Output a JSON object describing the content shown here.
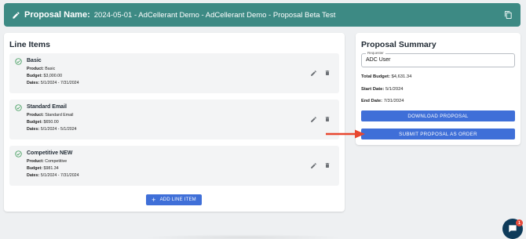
{
  "header": {
    "title_label": "Proposal Name:",
    "title_value": "2024-05-01 - AdCellerant Demo - AdCellerant Demo - Proposal Beta Test",
    "edit_icon": "pencil-icon",
    "copy_icon": "copy-icon"
  },
  "line_items": {
    "title": "Line Items",
    "items": [
      {
        "name": "Basic",
        "product_label": "Product:",
        "product": "Basic",
        "budget_label": "Budget:",
        "budget": "$3,000.00",
        "dates_label": "Dates:",
        "dates": "5/1/2024 - 7/31/2024"
      },
      {
        "name": "Standard Email",
        "product_label": "Product:",
        "product": "Standard Email",
        "budget_label": "Budget:",
        "budget": "$650.00",
        "dates_label": "Dates:",
        "dates": "5/1/2024 - 5/1/2024"
      },
      {
        "name": "Competitive NEW",
        "product_label": "Product:",
        "product": "Competitive",
        "budget_label": "Budget:",
        "budget": "$981.34",
        "dates_label": "Dates:",
        "dates": "5/1/2024 - 7/31/2024"
      }
    ],
    "add_button": "ADD LINE ITEM"
  },
  "summary": {
    "title": "Proposal Summary",
    "requester_label": "Requester",
    "requester_value": "ADC User",
    "total_budget_label": "Total Budget:",
    "total_budget": "$4,631.34",
    "start_date_label": "Start Date:",
    "start_date": "5/1/2024",
    "end_date_label": "End Date:",
    "end_date": "7/31/2024",
    "download_button": "DOWNLOAD PROPOSAL",
    "submit_button": "SUBMIT PROPOSAL AS ORDER"
  },
  "chat": {
    "badge_count": "1"
  },
  "colors": {
    "header_bg": "#3d8a84",
    "button_blue": "#3f6fd8",
    "check_green": "#3d9a5a",
    "arrow_red": "#e8472f"
  }
}
